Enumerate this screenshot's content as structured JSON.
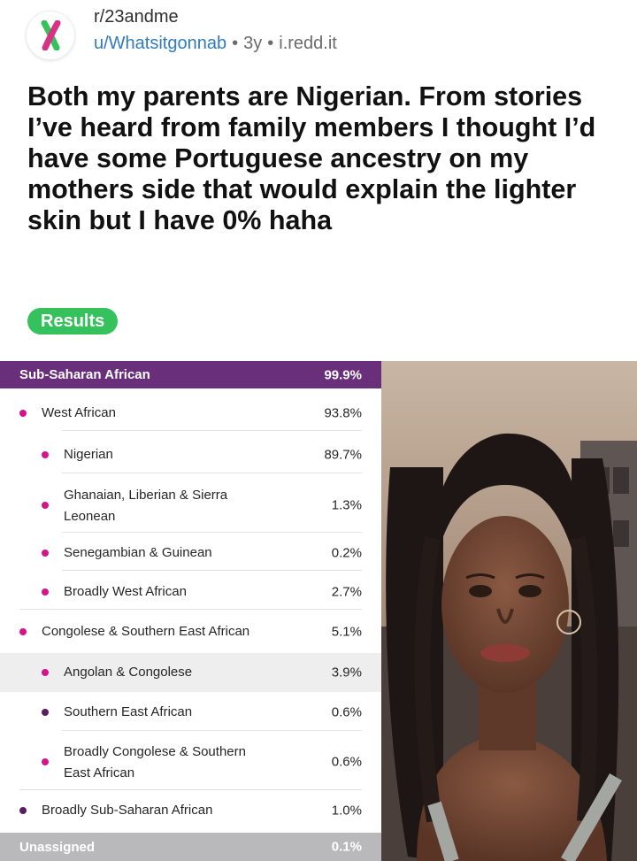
{
  "post": {
    "subreddit": "r/23andme",
    "author": "u/Whatsitgonnab",
    "age": "3y",
    "domain": "i.redd.it",
    "separator": "•",
    "title": "Both my parents are Nigerian. From stories I’ve heard from family members I thought I’d have some Portuguese ancestry on my mothers side that would explain the lighter skin but I have 0% haha",
    "flair": "Results"
  },
  "colors": {
    "brand_green": "#35c15b",
    "brand_pink": "#d63384",
    "header_purple": "#6a2f7a",
    "dot_pink": "#d4148c",
    "dot_purple": "#5b1d5f",
    "link_blue": "#2f7bbf"
  },
  "icons": {
    "subreddit": "23andme-logo-icon",
    "photo": "person-photo"
  },
  "ancestry": {
    "header": {
      "label": "Sub-Saharan African",
      "value": "99.9%"
    },
    "rows": [
      {
        "label": "West African",
        "value": "93.8%"
      },
      {
        "label": "Nigerian",
        "value": "89.7%"
      },
      {
        "label": "Ghanaian, Liberian & Sierra",
        "label2": "Leonean",
        "value": "1.3%"
      },
      {
        "label": "Senegambian & Guinean",
        "value": "0.2%"
      },
      {
        "label": "Broadly West African",
        "value": "2.7%"
      },
      {
        "label": "Congolese & Southern East African",
        "value": "5.1%"
      },
      {
        "label": "Angolan & Congolese",
        "value": "3.9%"
      },
      {
        "label": "Southern East African",
        "value": "0.6%"
      },
      {
        "label": "Broadly Congolese & Southern",
        "label2": "East African",
        "value": "0.6%"
      },
      {
        "label": "Broadly Sub-Saharan African",
        "value": "1.0%"
      }
    ],
    "unassigned": {
      "label": "Unassigned",
      "value": "0.1%"
    }
  }
}
